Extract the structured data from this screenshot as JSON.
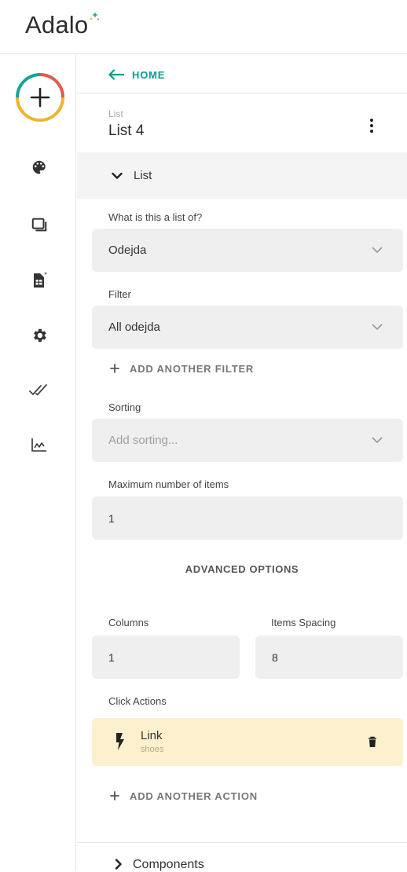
{
  "app": {
    "logo_text": "Adalo",
    "accent_color": "#0e9c8e"
  },
  "sidebar": {
    "add_button_icon": "plus-icon",
    "items": [
      {
        "icon": "palette-icon"
      },
      {
        "icon": "screens-icon"
      },
      {
        "icon": "database-icon"
      },
      {
        "icon": "gear-icon"
      },
      {
        "icon": "check-all-icon"
      },
      {
        "icon": "analytics-icon"
      }
    ]
  },
  "nav": {
    "back_label": "HOME"
  },
  "component": {
    "type_label": "List",
    "name": "List 4"
  },
  "section": {
    "title": "List"
  },
  "form": {
    "list_of": {
      "label": "What is this a list of?",
      "value": "Odejda"
    },
    "filter": {
      "label": "Filter",
      "value": "All odejda"
    },
    "add_filter_label": "ADD ANOTHER FILTER",
    "sorting": {
      "label": "Sorting",
      "placeholder": "Add sorting..."
    },
    "max_items": {
      "label": "Maximum number of items",
      "value": "1"
    },
    "advanced_options_label": "ADVANCED OPTIONS",
    "columns": {
      "label": "Columns",
      "value": "1"
    },
    "items_spacing": {
      "label": "Items Spacing",
      "value": "8"
    },
    "click_actions_label": "Click Actions",
    "action": {
      "title": "Link",
      "subtitle": "shoes"
    },
    "add_action_label": "ADD ANOTHER ACTION"
  },
  "components_section": {
    "title": "Components"
  }
}
